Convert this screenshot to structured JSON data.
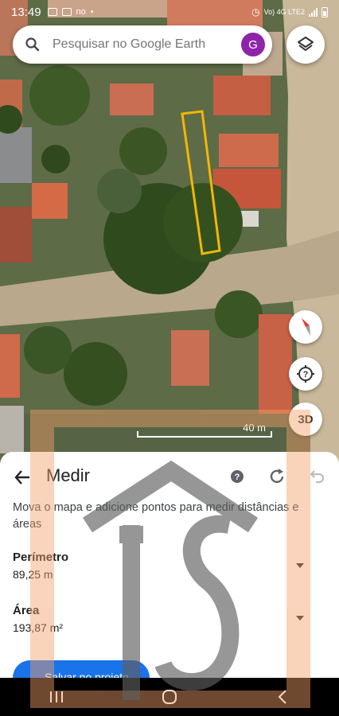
{
  "status_bar": {
    "time": "13:49",
    "left_extra": "no",
    "network": "Vo) 4G LTE2",
    "icons": [
      "image-icon",
      "notification-icon",
      "dot-icon",
      "alarm-icon",
      "signal-icon",
      "battery-icon"
    ]
  },
  "search": {
    "placeholder": "Pesquisar no Google Earth",
    "avatar_letter": "G",
    "avatar_color": "#8e24aa"
  },
  "map": {
    "scale_label": "40 m",
    "button_3d": "3D",
    "measured_outline_color": "#f2b705"
  },
  "measure_panel": {
    "title": "Medir",
    "instructions": "Mova o mapa e adicione pontos para medir distâncias e áreas",
    "perimeter_label": "Perímetro",
    "perimeter_value": "89,25 m",
    "area_label": "Área",
    "area_value": "193,87 m²",
    "save_button": "Salvar no projeto"
  },
  "colors": {
    "accent": "#1a73e8",
    "watermark_orange": "#f5a06a",
    "watermark_gray": "#5f5f5f"
  }
}
